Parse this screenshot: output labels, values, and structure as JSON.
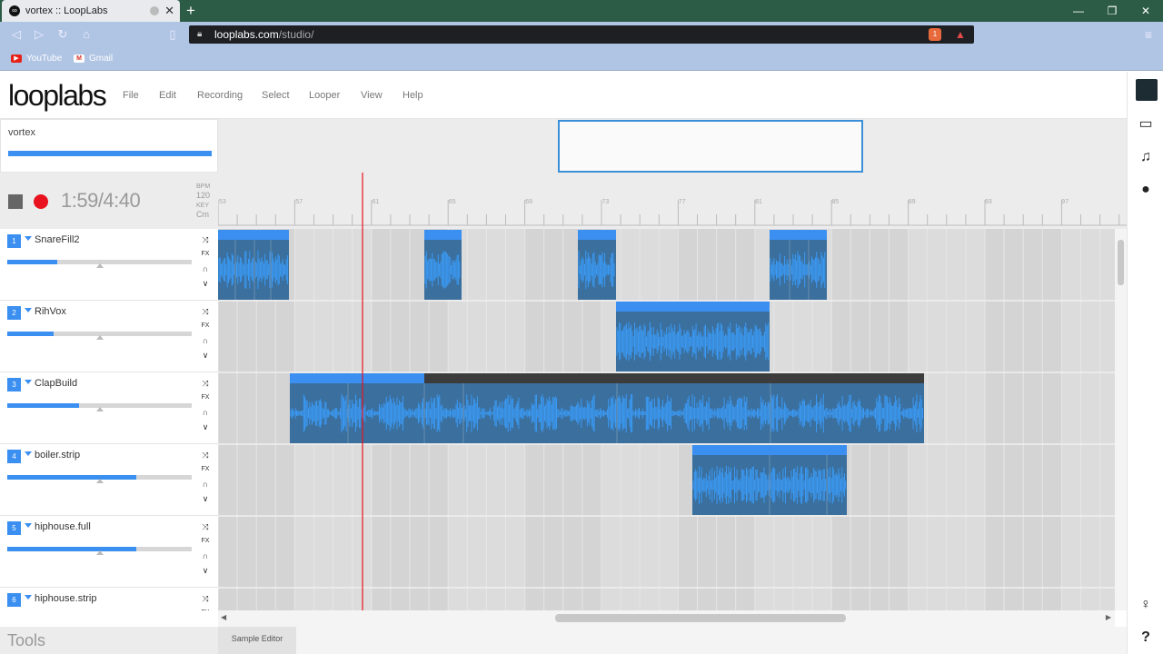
{
  "browser": {
    "tab_title": "vortex :: LoopLabs",
    "tab_close": "✕",
    "new_tab": "+",
    "url_domain": "looplabs.com",
    "url_path": "/studio/",
    "bookmarks": [
      {
        "label": "YouTube",
        "color": "#e62117"
      },
      {
        "label": "Gmail",
        "color": "#d93025"
      }
    ],
    "brave_count": "1"
  },
  "app": {
    "logo": "looplabs",
    "menu": [
      "File",
      "Edit",
      "Recording",
      "Select",
      "Looper",
      "View",
      "Help"
    ],
    "project_name": "vortex",
    "accent": "#3a8ff0",
    "record_color": "#e8131f"
  },
  "transport": {
    "time": "1:59/4:40",
    "bpm_label": "BPM",
    "bpm": "120",
    "key_label": "KEY",
    "key": "Cm"
  },
  "ruler": {
    "bars": [
      "53",
      "57",
      "61",
      "65",
      "69",
      "73",
      "77",
      "81",
      "85",
      "89",
      "93",
      "97"
    ]
  },
  "tracks": [
    {
      "num": "1",
      "name": "SnareFill2",
      "volume": 0.27
    },
    {
      "num": "2",
      "name": "RihVox",
      "volume": 0.25
    },
    {
      "num": "3",
      "name": "ClapBuild",
      "volume": 0.39
    },
    {
      "num": "4",
      "name": "boiler.strip",
      "volume": 0.7
    },
    {
      "num": "5",
      "name": "hiphouse.full",
      "volume": 0.7
    },
    {
      "num": "6",
      "name": "hiphouse.strip",
      "volume": 0.7
    }
  ],
  "track_icons": {
    "fx": "FX"
  },
  "bottom": {
    "tools": "Tools",
    "sample_editor": "Sample Editor"
  },
  "scroll": {
    "horizontal_position": 0.38
  }
}
